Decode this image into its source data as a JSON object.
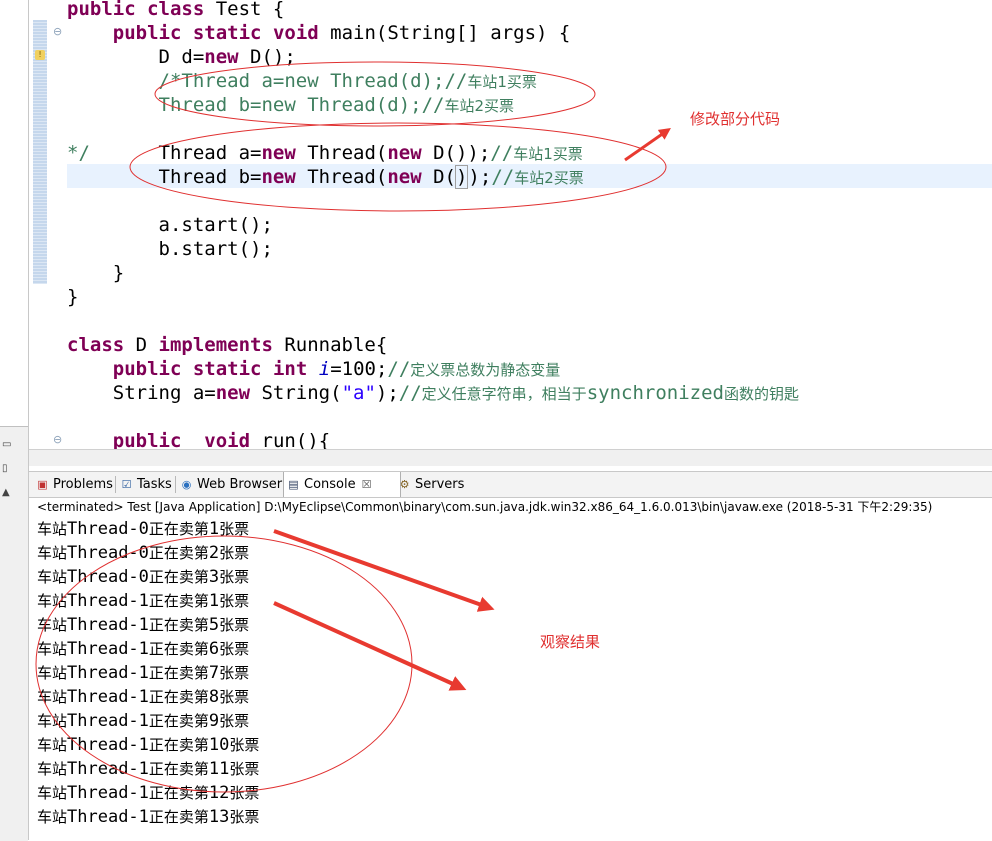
{
  "editor": {
    "lines": {
      "l1": {
        "kw1": "public",
        "kw2": "class",
        "rest": " Test {"
      },
      "l2": {
        "kw1": "public",
        "kw2": "static",
        "kw3": "void",
        "rest": " main(String[] args) {"
      },
      "l3": {
        "a": "D d=",
        "kw": "new",
        "b": " D();"
      },
      "l4": {
        "code": "/*Thread a=new Thread(d);//",
        "cjk": "车站1买票"
      },
      "l5": {
        "code": "Thread b=new Thread(d);//",
        "cjk": "车站2买票"
      },
      "l7": {
        "comment_end": "*/",
        "a": "Thread a=",
        "kw1": "new",
        "b": " Thread(",
        "kw2": "new",
        "c": " D());",
        "cm": "//",
        "cjk": "车站1买票"
      },
      "l8": {
        "a": "Thread b=",
        "kw1": "new",
        "b": " Thread(",
        "kw2": "new",
        "c": " D(",
        "paren": ")",
        ")rest": ");",
        "cm": "//",
        "cjk": "车站2买票"
      },
      "l10": {
        "code": "a.start();"
      },
      "l11": {
        "code": "b.start();"
      },
      "l12": {
        "code": "}"
      },
      "l13": {
        "code": "}"
      },
      "l15": {
        "kw1": "class",
        "a": " D ",
        "kw2": "implements",
        "b": " Runnable{"
      },
      "l16": {
        "kw1": "public",
        "kw2": "static",
        "kw3": "int",
        "field": "i",
        "b": "=100;",
        "cm": "//",
        "cjk": "定义票总数为静态变量"
      },
      "l17": {
        "a": "String a=",
        "kw": "new",
        "b": " String(",
        "str": "\"a\"",
        "c": ");",
        "cm": "//",
        "cjk": "定义任意字符串，相当于",
        "cm2": "synchronized",
        "cjk2": "函数的钥匙"
      },
      "l19": {
        "kw1": "public",
        "kw2": "void",
        "rest": " run(){"
      }
    }
  },
  "tabs": [
    {
      "label": "Problems",
      "icon": "problems-icon"
    },
    {
      "label": "Tasks",
      "icon": "tasks-icon"
    },
    {
      "label": "Web Browser",
      "icon": "globe-icon"
    },
    {
      "label": "Console",
      "icon": "console-icon",
      "close": "☒"
    },
    {
      "label": "Servers",
      "icon": "servers-icon"
    }
  ],
  "console": {
    "header": "<terminated> Test [Java Application] D:\\MyEclipse\\Common\\binary\\com.sun.java.jdk.win32.x86_64_1.6.0.013\\bin\\javaw.exe (2018-5-31 下午2:29:35)",
    "lines": [
      {
        "prefix": "车站",
        "thread": "Thread-0",
        "mid": "正在卖第",
        "num": "1",
        "suffix": "张票"
      },
      {
        "prefix": "车站",
        "thread": "Thread-0",
        "mid": "正在卖第",
        "num": "2",
        "suffix": "张票"
      },
      {
        "prefix": "车站",
        "thread": "Thread-0",
        "mid": "正在卖第",
        "num": "3",
        "suffix": "张票"
      },
      {
        "prefix": "车站",
        "thread": "Thread-1",
        "mid": "正在卖第",
        "num": "1",
        "suffix": "张票"
      },
      {
        "prefix": "车站",
        "thread": "Thread-1",
        "mid": "正在卖第",
        "num": "5",
        "suffix": "张票"
      },
      {
        "prefix": "车站",
        "thread": "Thread-1",
        "mid": "正在卖第",
        "num": "6",
        "suffix": "张票"
      },
      {
        "prefix": "车站",
        "thread": "Thread-1",
        "mid": "正在卖第",
        "num": "7",
        "suffix": "张票"
      },
      {
        "prefix": "车站",
        "thread": "Thread-1",
        "mid": "正在卖第",
        "num": "8",
        "suffix": "张票"
      },
      {
        "prefix": "车站",
        "thread": "Thread-1",
        "mid": "正在卖第",
        "num": "9",
        "suffix": "张票"
      },
      {
        "prefix": "车站",
        "thread": "Thread-1",
        "mid": "正在卖第",
        "num": "10",
        "suffix": "张票"
      },
      {
        "prefix": "车站",
        "thread": "Thread-1",
        "mid": "正在卖第",
        "num": "11",
        "suffix": "张票"
      },
      {
        "prefix": "车站",
        "thread": "Thread-1",
        "mid": "正在卖第",
        "num": "12",
        "suffix": "张票"
      },
      {
        "prefix": "车站",
        "thread": "Thread-1",
        "mid": "正在卖第",
        "num": "13",
        "suffix": "张票"
      }
    ]
  },
  "annotations": {
    "modify_label": "修改部分代码",
    "observe_label": "观察结果",
    "color": "#e03030"
  },
  "colors": {
    "keyword": "#7f0055",
    "comment": "#3f7f5f",
    "string": "#2a00ff",
    "field": "#0000c0",
    "current_line": "#e8f2fe"
  }
}
